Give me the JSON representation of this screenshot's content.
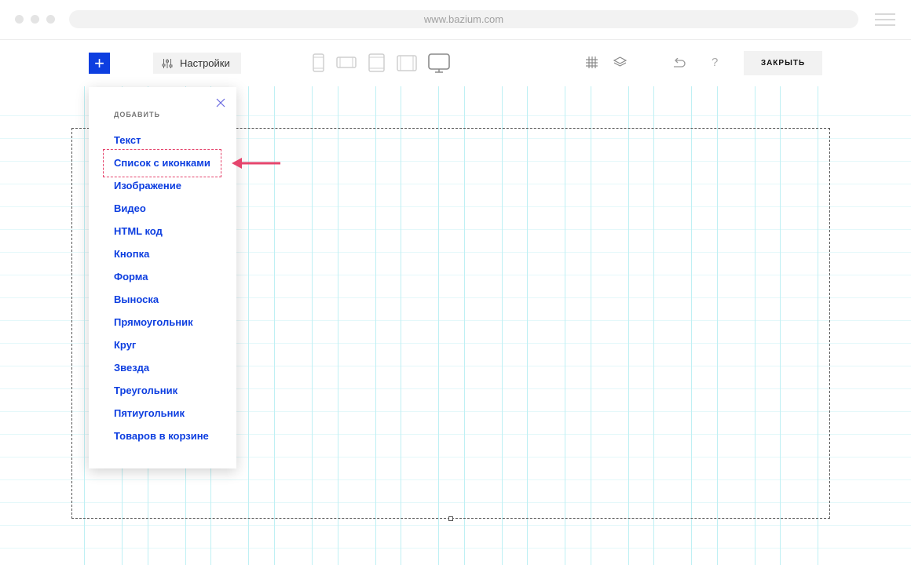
{
  "browser": {
    "url": "www.bazium.com"
  },
  "toolbar": {
    "add_label": "+",
    "settings_label": "Настройки",
    "close_label": "ЗАКРЫТЬ",
    "help_label": "?",
    "devices": [
      "phone-portrait-icon",
      "phone-landscape-icon",
      "tablet-portrait-icon",
      "tablet-landscape-icon",
      "desktop-icon"
    ],
    "selected_device": "desktop"
  },
  "panel": {
    "title": "ДОБАВИТЬ",
    "items": [
      "Текст",
      "Список с иконками",
      "Изображение",
      "Видео",
      "HTML код",
      "Кнопка",
      "Форма",
      "Выноска",
      "Прямоугольник",
      "Круг",
      "Звезда",
      "Треугольник",
      "Пятиугольник",
      "Товаров в корзине"
    ],
    "highlighted_item": "Список с иконками"
  },
  "colors": {
    "accent": "#0d3ee0",
    "highlight": "#e5456d",
    "grid": "#c9f0f5"
  }
}
